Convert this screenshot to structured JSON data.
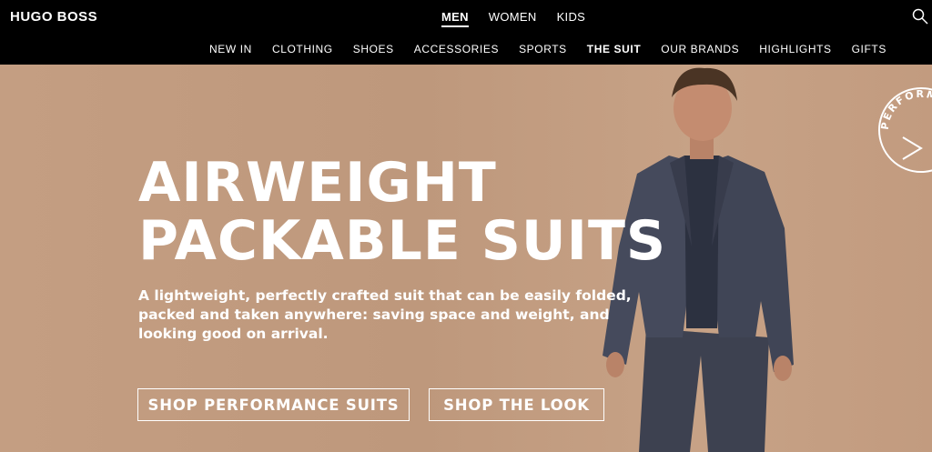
{
  "header": {
    "logo": "HUGO BOSS",
    "gender_tabs": [
      "MEN",
      "WOMEN",
      "KIDS"
    ],
    "active_gender": "MEN",
    "categories": [
      "NEW IN",
      "CLOTHING",
      "SHOES",
      "ACCESSORIES",
      "SPORTS",
      "THE SUIT",
      "OUR BRANDS",
      "HIGHLIGHTS",
      "GIFTS"
    ],
    "active_category": "THE SUIT",
    "search_icon": "search-icon"
  },
  "hero": {
    "headline_line1": "AIRWEIGHT",
    "headline_line2": "PACKABLE SUITS",
    "subtext": "A lightweight, perfectly crafted suit that can be easily folded, packed and taken anywhere: saving space and weight, and looking good on arrival.",
    "cta_primary": "SHOP PERFORMANCE SUITS",
    "cta_secondary": "SHOP THE LOOK",
    "badge_text": "PERFORMANCE",
    "background_color": "#c29b7f"
  }
}
